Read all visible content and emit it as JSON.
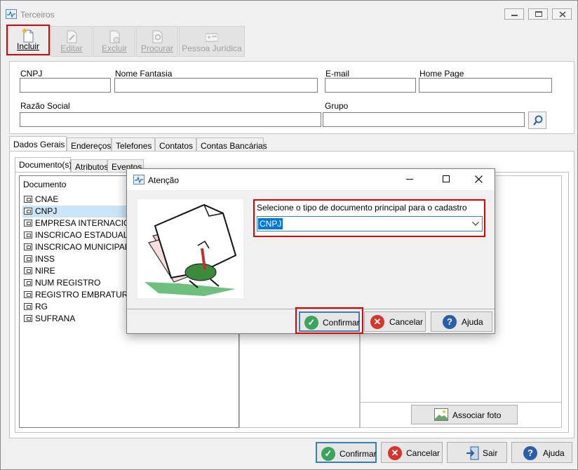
{
  "window": {
    "title": "Terceiros"
  },
  "toolbar": [
    {
      "label": "Incluir",
      "icon": "new-document-icon",
      "enabled": true
    },
    {
      "label": "Editar",
      "icon": "edit-document-icon",
      "enabled": false
    },
    {
      "label": "Excluir",
      "icon": "delete-document-icon",
      "enabled": false
    },
    {
      "label": "Procurar",
      "icon": "search-document-icon",
      "enabled": false
    },
    {
      "label": "Pessoa Jurídica",
      "icon": "id-card-icon",
      "enabled": false
    }
  ],
  "form": {
    "cnpj_label": "CNPJ",
    "nome_fantasia_label": "Nome Fantasia",
    "email_label": "E-mail",
    "homepage_label": "Home Page",
    "razao_social_label": "Razão Social",
    "grupo_label": "Grupo",
    "cnpj_value": "",
    "nome_fantasia_value": "",
    "email_value": "",
    "homepage_value": "",
    "razao_social_value": "",
    "grupo_value": ""
  },
  "tabs": [
    "Dados Gerais",
    "Endereços",
    "Telefones",
    "Contatos",
    "Contas Bancárias"
  ],
  "subtabs": [
    "Documento(s)",
    "Atributos",
    "Eventos"
  ],
  "documents": {
    "header": "Documento",
    "items": [
      "CNAE",
      "CNPJ",
      "EMPRESA INTERNACIONAL",
      "INSCRICAO ESTADUAL",
      "INSCRICAO MUNICIPAL",
      "INSS",
      "NIRE",
      "NUM REGISTRO",
      "REGISTRO EMBRATUR",
      "RG",
      "SUFRANA"
    ],
    "selected": "CNPJ"
  },
  "photo_button": "Associar foto",
  "footer": {
    "confirm": "Confirmar",
    "cancel": "Cancelar",
    "exit": "Sair",
    "help": "Ajuda"
  },
  "dialog": {
    "title": "Atenção",
    "prompt": "Selecione o tipo de documento principal para o cadastro",
    "selected_value": "CNPJ",
    "confirm": "Confirmar",
    "cancel": "Cancelar",
    "help": "Ajuda"
  },
  "colors": {
    "highlight_border": "#e00000",
    "selection": "#cce4f7",
    "select_highlight": "#0078d7",
    "confirm_green": "#3aa55a",
    "cancel_red": "#d9342b",
    "help_blue": "#2a5ea8"
  }
}
